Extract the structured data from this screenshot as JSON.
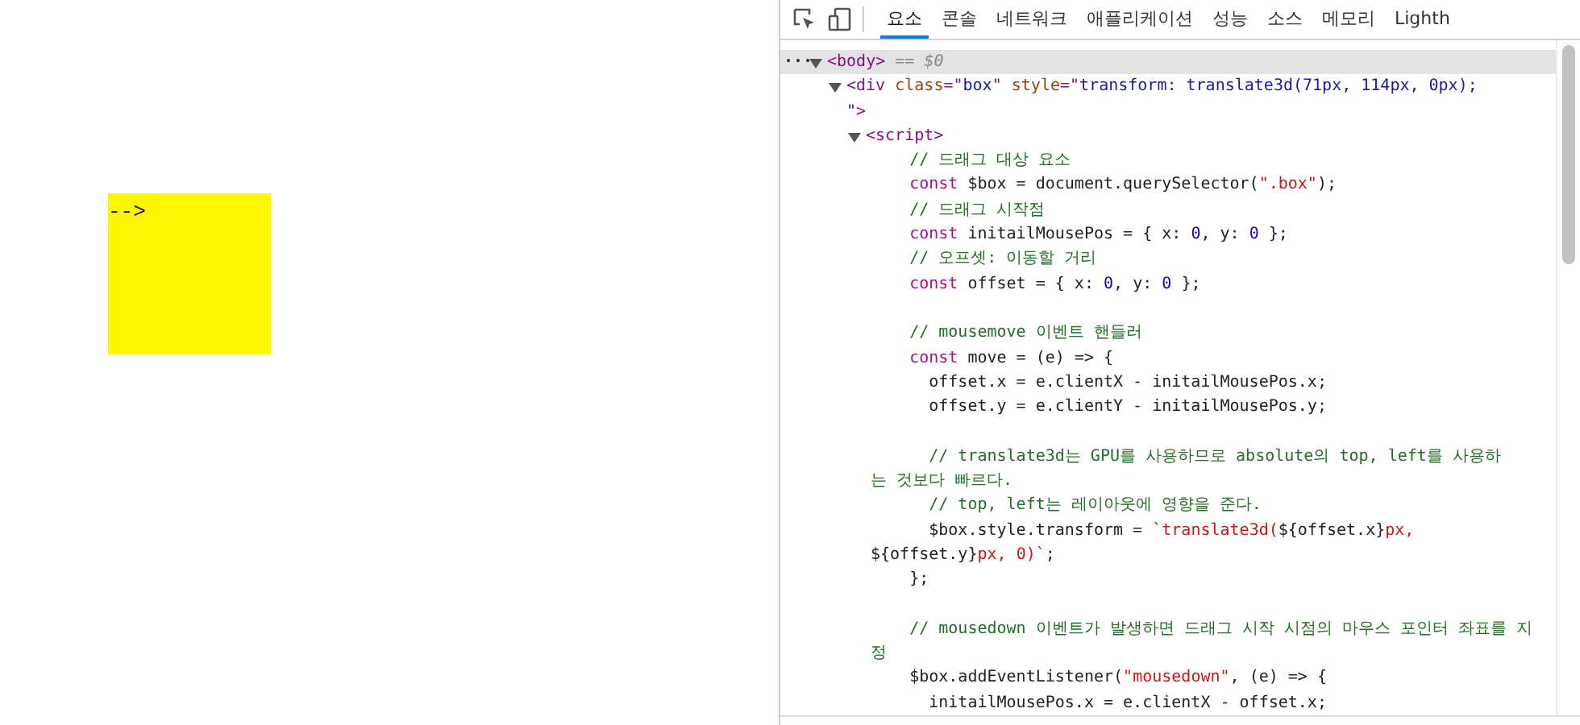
{
  "page": {
    "box_text": "-->"
  },
  "devtools": {
    "tabs": [
      {
        "label": "요소",
        "selected": true
      },
      {
        "label": "콘솔",
        "selected": false
      },
      {
        "label": "네트워크",
        "selected": false
      },
      {
        "label": "애플리케이션",
        "selected": false
      },
      {
        "label": "성능",
        "selected": false
      },
      {
        "label": "소스",
        "selected": false
      },
      {
        "label": "메모리",
        "selected": false
      },
      {
        "label": "Lighth",
        "selected": false
      }
    ],
    "dom_rows": [
      {
        "kind": "toggle",
        "expanded": true,
        "selected": true,
        "more": "···",
        "tokens": [
          {
            "kind": "tag",
            "text": "<body>"
          },
          {
            "kind": "dim",
            "text": " == $0"
          }
        ]
      },
      {
        "kind": "toggle",
        "expanded": true,
        "selected": false,
        "tokens": [
          {
            "kind": "tag",
            "text": "<div"
          },
          {
            "kind": "attr",
            "text": " class"
          },
          {
            "kind": "tag",
            "text": "=\""
          },
          {
            "kind": "value",
            "text": "box"
          },
          {
            "kind": "tag",
            "text": "\""
          },
          {
            "kind": "attr",
            "text": " style"
          },
          {
            "kind": "tag",
            "text": "=\""
          },
          {
            "kind": "value",
            "text": "transform: translate3d(71px, 114px, 0px);"
          }
        ]
      },
      {
        "kind": "text",
        "tokens": [
          {
            "kind": "value",
            "text": "\""
          },
          {
            "kind": "tag",
            "text": ">"
          }
        ]
      },
      {
        "kind": "toggle",
        "expanded": true,
        "selected": false,
        "tokens": [
          {
            "kind": "tag",
            "text": "<script>"
          }
        ]
      }
    ],
    "code_lines": [
      {
        "kind": "code",
        "tokens": [
          {
            "kind": "comment",
            "text": "    // 드래그 대상 요소"
          }
        ]
      },
      {
        "kind": "code",
        "tokens": [
          {
            "kind": "keyword",
            "text": "    const"
          },
          {
            "kind": "plain",
            "text": " $box = document.querySelector("
          },
          {
            "kind": "string",
            "text": "\".box\""
          },
          {
            "kind": "plain",
            "text": ");"
          }
        ]
      },
      {
        "kind": "code",
        "tokens": [
          {
            "kind": "comment",
            "text": "    // 드래그 시작점"
          }
        ]
      },
      {
        "kind": "code",
        "tokens": [
          {
            "kind": "keyword",
            "text": "    const"
          },
          {
            "kind": "plain",
            "text": " initailMousePos = { x: "
          },
          {
            "kind": "number",
            "text": "0"
          },
          {
            "kind": "plain",
            "text": ", y: "
          },
          {
            "kind": "number",
            "text": "0"
          },
          {
            "kind": "plain",
            "text": " };"
          }
        ]
      },
      {
        "kind": "code",
        "tokens": [
          {
            "kind": "comment",
            "text": "    // 오프셋: 이동할 거리"
          }
        ]
      },
      {
        "kind": "code",
        "tokens": [
          {
            "kind": "keyword",
            "text": "    const"
          },
          {
            "kind": "plain",
            "text": " offset = { x: "
          },
          {
            "kind": "number",
            "text": "0"
          },
          {
            "kind": "plain",
            "text": ", y: "
          },
          {
            "kind": "number",
            "text": "0"
          },
          {
            "kind": "plain",
            "text": " };"
          }
        ]
      },
      {
        "kind": "blank"
      },
      {
        "kind": "code",
        "tokens": [
          {
            "kind": "comment",
            "text": "    // mousemove 이벤트 핸들러"
          }
        ]
      },
      {
        "kind": "code",
        "tokens": [
          {
            "kind": "keyword",
            "text": "    const"
          },
          {
            "kind": "plain",
            "text": " move = (e) => {"
          }
        ]
      },
      {
        "kind": "code",
        "tokens": [
          {
            "kind": "plain",
            "text": "      offset.x = e.clientX - initailMousePos.x;"
          }
        ]
      },
      {
        "kind": "code",
        "tokens": [
          {
            "kind": "plain",
            "text": "      offset.y = e.clientY - initailMousePos.y;"
          }
        ]
      },
      {
        "kind": "blank"
      },
      {
        "kind": "code",
        "tokens": [
          {
            "kind": "comment",
            "text": "      // translate3d는 GPU를 사용하므로 absolute의 top, left를 사용하"
          }
        ]
      },
      {
        "kind": "code",
        "tokens": [
          {
            "kind": "comment",
            "text": "는 것보다 빠르다."
          }
        ]
      },
      {
        "kind": "code",
        "tokens": [
          {
            "kind": "comment",
            "text": "      // top, left는 레이아웃에 영향을 준다."
          }
        ]
      },
      {
        "kind": "code",
        "tokens": [
          {
            "kind": "plain",
            "text": "      $box.style.transform = "
          },
          {
            "kind": "string",
            "text": "`translate3d("
          },
          {
            "kind": "plain",
            "text": "${offset.x}"
          },
          {
            "kind": "string",
            "text": "px,"
          }
        ]
      },
      {
        "kind": "code",
        "tokens": [
          {
            "kind": "plain",
            "text": "${offset.y}"
          },
          {
            "kind": "string",
            "text": "px, 0)`"
          },
          {
            "kind": "plain",
            "text": ";"
          }
        ]
      },
      {
        "kind": "code",
        "tokens": [
          {
            "kind": "plain",
            "text": "    };"
          }
        ]
      },
      {
        "kind": "blank"
      },
      {
        "kind": "code",
        "tokens": [
          {
            "kind": "comment",
            "text": "    // mousedown 이벤트가 발생하면 드래그 시작 시점의 마우스 포인터 좌표를 지"
          }
        ]
      },
      {
        "kind": "code",
        "tokens": [
          {
            "kind": "comment",
            "text": "정"
          }
        ]
      },
      {
        "kind": "code",
        "tokens": [
          {
            "kind": "plain",
            "text": "    $box.addEventListener("
          },
          {
            "kind": "string",
            "text": "\"mousedown\""
          },
          {
            "kind": "plain",
            "text": ", (e) => {"
          }
        ]
      },
      {
        "kind": "code",
        "tokens": [
          {
            "kind": "plain",
            "text": "      initailMousePos.x = e.clientX - offset.x;"
          }
        ]
      }
    ]
  }
}
